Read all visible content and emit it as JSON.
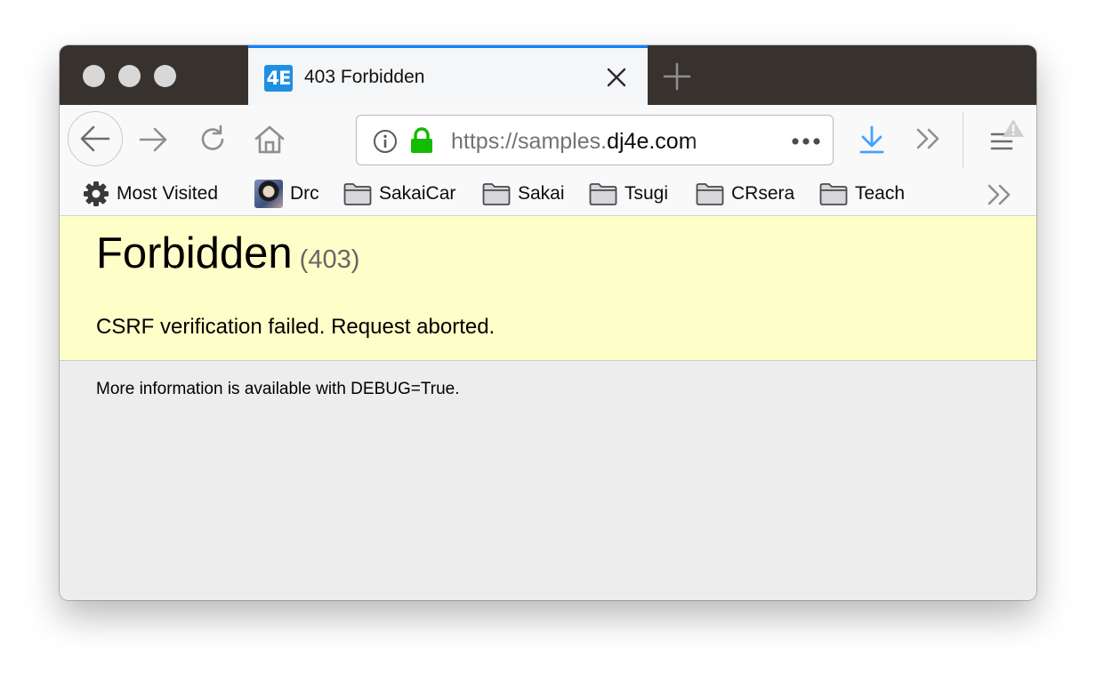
{
  "browser": {
    "tab": {
      "favicon_text": "4E",
      "title": "403 Forbidden"
    },
    "url": {
      "scheme_prefix": "https://samples.",
      "domain": "dj4e.com"
    },
    "bookmarks": [
      {
        "label": "Most Visited",
        "icon": "gear-icon"
      },
      {
        "label": "Drc",
        "icon": "avatar-icon"
      },
      {
        "label": "SakaiCar",
        "icon": "folder-icon"
      },
      {
        "label": "Sakai",
        "icon": "folder-icon"
      },
      {
        "label": "Tsugi",
        "icon": "folder-icon"
      },
      {
        "label": "CRsera",
        "icon": "folder-icon"
      },
      {
        "label": "Teach",
        "icon": "folder-icon"
      }
    ],
    "colors": {
      "tab_accent": "#0a84ff",
      "favicon_bg": "#1e8fe1",
      "lock_green": "#12bc00",
      "download_blue": "#45a1ff",
      "summary_bg": "#fefec8"
    }
  },
  "page": {
    "title": "Forbidden",
    "status_code": "(403)",
    "reason": "CSRF verification failed. Request aborted.",
    "explanation": "More information is available with DEBUG=True."
  }
}
